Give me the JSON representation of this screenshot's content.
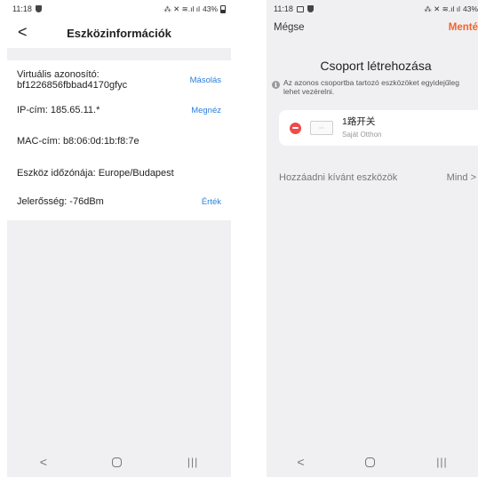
{
  "left": {
    "status": {
      "time": "11:18",
      "icons": "⁂ ✕ ≋.ıl ıl",
      "battery": "43%"
    },
    "header": {
      "back_glyph": "<",
      "title": "Eszközinformációk"
    },
    "rows": {
      "virtual_id": {
        "text": "Virtuális azonosító:\nbf1226856fbbad4170gfyc",
        "action": "Másolás"
      },
      "ip": {
        "text": "IP-cím: 185.65.11.*",
        "action": "Megnéz"
      },
      "mac": {
        "text": "MAC-cím: b8:06:0d:1b:f8:7e"
      },
      "timezone": {
        "text": "Eszköz időzónája: Europe/Budapest"
      },
      "signal": {
        "text": "Jelerősség: -76dBm",
        "action": "Érték"
      }
    },
    "nav": {
      "back": "<",
      "recent": "|||"
    }
  },
  "right": {
    "status": {
      "time": "11:18",
      "icons": "⁂ ✕ ≋.ıl ıl",
      "battery": "43%"
    },
    "topbar": {
      "cancel": "Mégse",
      "save": "Menté"
    },
    "title": "Csoport létrehozása",
    "hint": "Az azonos csoportba tartozó eszközöket egyidejűleg lehet vezérelni.",
    "device": {
      "name": "1路开关",
      "room": "Saját Otthon"
    },
    "add_row": {
      "label": "Hozzáadni kívánt eszközök",
      "all": "Mind >"
    },
    "nav": {
      "back": "<",
      "recent": "|||"
    }
  },
  "colors": {
    "accent_blue": "#2a7fdc",
    "save_orange": "#f0642f",
    "remove_red": "#f04a4a"
  }
}
